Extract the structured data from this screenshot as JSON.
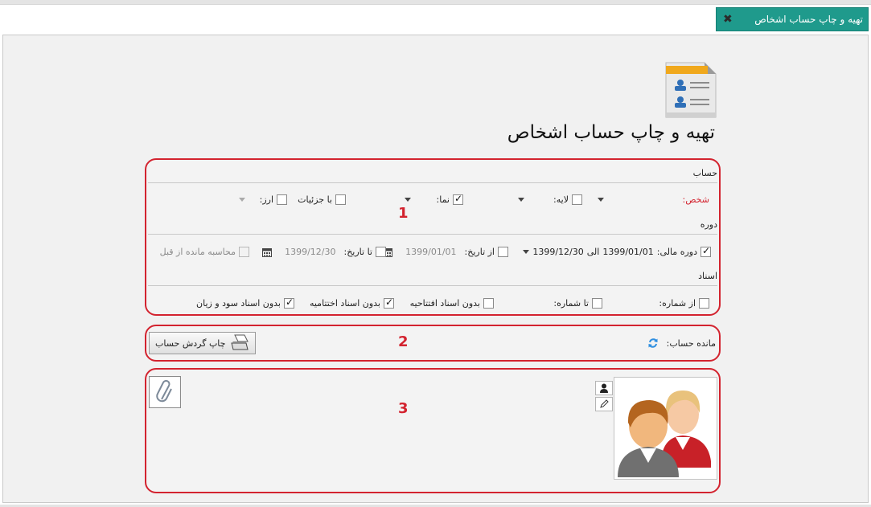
{
  "tab": {
    "title": "تهیه و چاپ حساب اشخاص",
    "close_icon": "close-icon"
  },
  "page": {
    "title": "تهیه و چاپ حساب اشخاص",
    "icon": "contacts-document-icon"
  },
  "annotations": {
    "group1": "1",
    "group2": "2",
    "group3": "3"
  },
  "account": {
    "section_label": "حساب",
    "person_label": "شخص:",
    "layer_label": "لایه:",
    "layer_checked": false,
    "nama_label": "نما:",
    "nama_checked": true,
    "details_label": "با جزئیات",
    "details_checked": false,
    "currency_label": "ارز:",
    "currency_checked": false
  },
  "period": {
    "section_label": "دوره",
    "fiscal_checked": true,
    "fiscal_label": "دوره مالی:",
    "fiscal_from": "1399/01/01",
    "fiscal_between": "الی",
    "fiscal_to": "1399/12/30",
    "from_date_label": "از تاریخ:",
    "from_date_value": "1399/01/01",
    "to_date_label": "تا تاریخ:",
    "to_date_value": "1399/12/30",
    "calc_prior_label": "محاسبه مانده از قبل"
  },
  "documents": {
    "section_label": "اسناد",
    "from_number_label": "از شماره:",
    "to_number_label": "تا شماره:",
    "no_opening_label": "بدون اسناد افتتاحیه",
    "no_opening_checked": false,
    "no_closing_label": "بدون اسناد اختتامیه",
    "no_closing_checked": true,
    "no_pl_label": "بدون اسناد سود و زیان",
    "no_pl_checked": true
  },
  "balance": {
    "label": "مانده حساب:",
    "refresh_icon": "refresh-icon",
    "print_button": "چاپ گردش حساب",
    "print_icon": "print-icon"
  },
  "person_card": {
    "attach_icon": "paperclip-icon",
    "person_icon": "person-icon",
    "edit_icon": "pencil-icon",
    "avatar_icon": "people-avatar-icon"
  },
  "colors": {
    "tab_bg": "#1f9a8c",
    "highlight": "#d3232f",
    "required_label": "#d3232f"
  }
}
